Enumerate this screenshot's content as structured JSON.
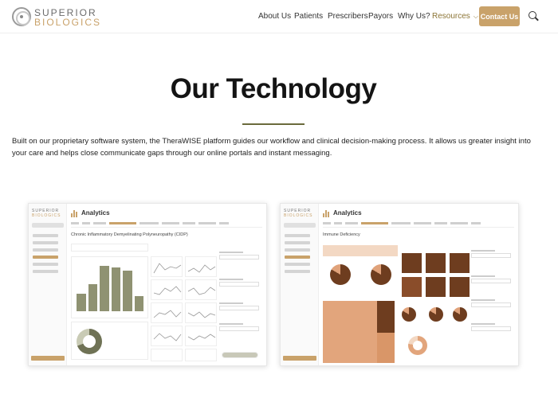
{
  "header": {
    "logo_top": "SUPERIOR",
    "logo_bottom": "BIOLOGICS",
    "nav": [
      "About Us",
      "Patients",
      "Prescribers",
      "Payors",
      "Why Us?",
      "Resources"
    ],
    "contact_label": "Contact Us",
    "accent_color": "#c9a26a"
  },
  "hero": {
    "title": "Our Technology",
    "intro": "Built on our proprietary software system, the TheraWISE platform guides our workflow and clinical decision-making process. It allows us greater insight into your care and helps close communicate gaps through our online portals and instant messaging."
  },
  "screenshots": [
    {
      "app_title": "Analytics",
      "subtitle": "Chronic Inflammatory Demyelinating Polyneuropathy (CIDP)",
      "logo_top": "SUPERIOR",
      "logo_bottom": "BIOLOGICS",
      "bar_values": [
        0.35,
        0.55,
        0.92,
        0.88,
        0.82,
        0.3
      ]
    },
    {
      "app_title": "Analytics",
      "subtitle": "Immune Deficiency",
      "logo_top": "SUPERIOR",
      "logo_bottom": "BIOLOGICS"
    }
  ]
}
